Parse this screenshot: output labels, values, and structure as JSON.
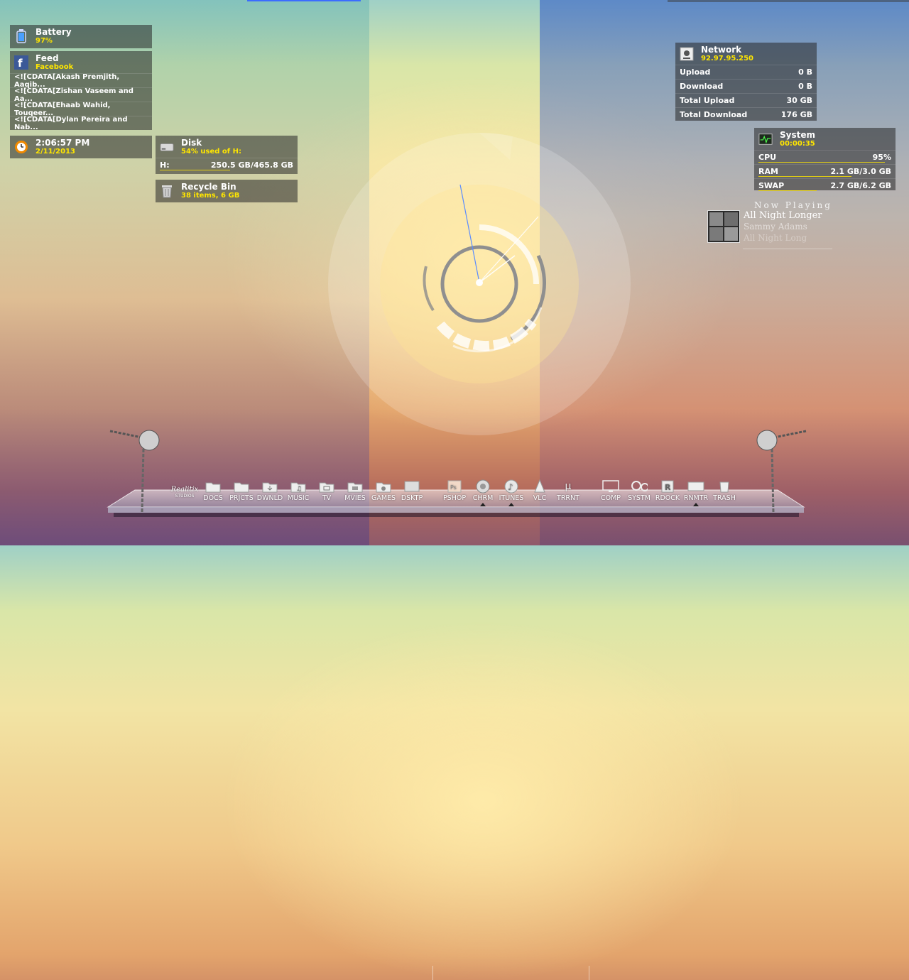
{
  "battery": {
    "title": "Battery",
    "value": "97%",
    "fill": 0.97
  },
  "feed": {
    "title": "Feed",
    "source": "Facebook",
    "items": [
      "<![CDATA[Akash Premjith, Aaqib...",
      "<![CDATA[Zishan Vaseem and Aa...",
      "<![CDATA[Ehaab Wahid, Touqeer...",
      "<![CDATA[Dylan Pereira and Nab..."
    ]
  },
  "clock": {
    "time": "2:06:57 PM",
    "date": "2/11/2013"
  },
  "disk": {
    "title": "Disk",
    "summary": "54% used of H:",
    "drive": "H:",
    "usage": "250.5 GB/465.8 GB",
    "used_fraction": 0.54
  },
  "recycle": {
    "title": "Recycle Bin",
    "summary": "38  items, 6 GB"
  },
  "network": {
    "title": "Network",
    "ip": "92.97.95.250",
    "rows": [
      {
        "label": "Upload",
        "value": "0 B"
      },
      {
        "label": "Download",
        "value": "0 B"
      },
      {
        "label": "Total Upload",
        "value": "30 GB"
      },
      {
        "label": "Total Download",
        "value": "176 GB"
      }
    ]
  },
  "system": {
    "title": "System",
    "uptime": "00:00:35",
    "rows": [
      {
        "label": "CPU",
        "value": "95%",
        "fraction": 0.95
      },
      {
        "label": "RAM",
        "value": "2.1 GB/3.0 GB",
        "fraction": 0.7
      },
      {
        "label": "SWAP",
        "value": "2.7 GB/6.2 GB",
        "fraction": 0.44
      }
    ]
  },
  "now_playing": {
    "label": "Now Playing",
    "track": "All Night Longer",
    "artist": "Sammy Adams",
    "album": "All Night Long"
  },
  "dock": {
    "logo_top": "Realitix",
    "logo_bottom": "STUDIOS",
    "items": [
      {
        "label": "DOCS",
        "icon": "folder-icon"
      },
      {
        "label": "PRJCTS",
        "icon": "folder-icon"
      },
      {
        "label": "DWNLD",
        "icon": "folder-download-icon"
      },
      {
        "label": "MUSIC",
        "icon": "folder-music-icon"
      },
      {
        "label": "TV",
        "icon": "folder-tv-icon"
      },
      {
        "label": "MVIES",
        "icon": "folder-movies-icon"
      },
      {
        "label": "GAMES",
        "icon": "folder-games-icon"
      },
      {
        "label": "DSKTP",
        "icon": "desktop-icon"
      },
      {
        "label": "PSHOP",
        "icon": "photoshop-icon"
      },
      {
        "label": "CHRM",
        "icon": "chrome-icon"
      },
      {
        "label": "ITUNES",
        "icon": "itunes-icon"
      },
      {
        "label": "VLC",
        "icon": "vlc-icon"
      },
      {
        "label": "TRRNT",
        "icon": "utorrent-icon"
      },
      {
        "label": "COMP",
        "icon": "computer-icon"
      },
      {
        "label": "SYSTM",
        "icon": "gears-icon"
      },
      {
        "label": "RDOCK",
        "icon": "rocketdock-icon"
      },
      {
        "label": "RNMTR",
        "icon": "rainmeter-icon"
      },
      {
        "label": "TRASH",
        "icon": "trash-icon"
      }
    ]
  },
  "colors": {
    "accent": "#ffe600",
    "panel_bg": "rgba(40,40,40,0.55)"
  }
}
